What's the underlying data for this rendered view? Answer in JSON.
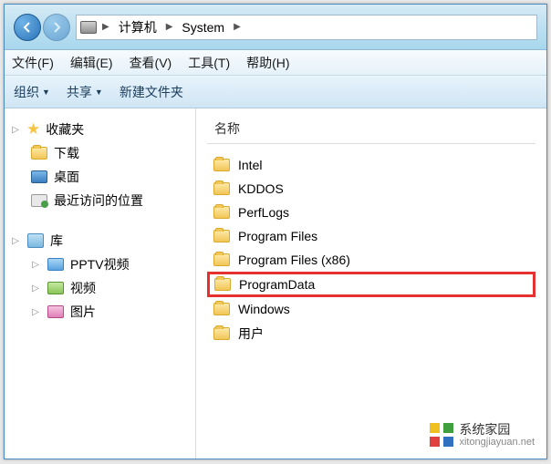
{
  "breadcrumb": {
    "root": "计算机",
    "path": "System"
  },
  "menubar": [
    {
      "label": "文件(F)"
    },
    {
      "label": "编辑(E)"
    },
    {
      "label": "查看(V)"
    },
    {
      "label": "工具(T)"
    },
    {
      "label": "帮助(H)"
    }
  ],
  "toolbar": {
    "organize": "组织",
    "share": "共享",
    "newfolder": "新建文件夹"
  },
  "sidebar": {
    "favorites": {
      "header": "收藏夹",
      "items": [
        {
          "label": "下载"
        },
        {
          "label": "桌面"
        },
        {
          "label": "最近访问的位置"
        }
      ]
    },
    "libraries": {
      "header": "库",
      "items": [
        {
          "label": "PPTV视频"
        },
        {
          "label": "视频"
        },
        {
          "label": "图片"
        }
      ]
    }
  },
  "content": {
    "column": "名称",
    "items": [
      {
        "label": "Intel"
      },
      {
        "label": "KDDOS"
      },
      {
        "label": "PerfLogs"
      },
      {
        "label": "Program Files"
      },
      {
        "label": "Program Files (x86)"
      },
      {
        "label": "ProgramData",
        "highlight": true
      },
      {
        "label": "Windows"
      },
      {
        "label": "用户"
      }
    ]
  },
  "watermark": {
    "title": "系统家园",
    "url": "xitongjiayuan.net"
  }
}
